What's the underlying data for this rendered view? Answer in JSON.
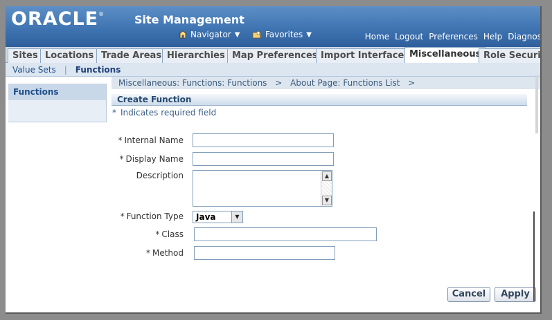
{
  "header": {
    "logo_text": "ORACLE",
    "logo_mark": "®",
    "app_title": "Site Management",
    "navigator_label": "Navigator",
    "favorites_label": "Favorites",
    "global_links": [
      "Home",
      "Logout",
      "Preferences",
      "Help",
      "Diagnosti"
    ]
  },
  "tabs": [
    {
      "label": "Sites",
      "active": false
    },
    {
      "label": "Locations",
      "active": false
    },
    {
      "label": "Trade Areas",
      "active": false
    },
    {
      "label": "Hierarchies",
      "active": false
    },
    {
      "label": "Map Preferences",
      "active": false
    },
    {
      "label": "Import Interface",
      "active": false
    },
    {
      "label": "Miscellaneous",
      "active": true
    },
    {
      "label": "Role Security",
      "active": false
    }
  ],
  "subtabs": {
    "items": [
      "Value Sets",
      "Functions"
    ],
    "separator": "|",
    "active": "Functions"
  },
  "sidenav": {
    "items": [
      "Functions"
    ]
  },
  "breadcrumb": {
    "items": [
      "Miscellaneous: Functions: Functions",
      "About Page: Functions List"
    ],
    "separator": ">"
  },
  "section": {
    "title": "Create Function",
    "required_note": "Indicates required field",
    "required_mark": "*"
  },
  "form": {
    "internal_name": {
      "label": "Internal Name",
      "required": true,
      "value": ""
    },
    "display_name": {
      "label": "Display Name",
      "required": true,
      "value": ""
    },
    "description": {
      "label": "Description",
      "required": false,
      "value": ""
    },
    "function_type": {
      "label": "Function Type",
      "required": true,
      "selected": "Java"
    },
    "class": {
      "label": "Class",
      "required": true,
      "value": ""
    },
    "method": {
      "label": "Method",
      "required": true,
      "value": ""
    }
  },
  "buttons": {
    "cancel": "Cancel",
    "apply": "Apply"
  },
  "icons": {
    "navigator": "house-icon",
    "favorites": "star-folder-icon",
    "dropdown": "triangle-down-icon"
  },
  "colors": {
    "header_blue": "#3f74b2",
    "tab_bg": "#cfdce9",
    "link_blue": "#1f4f8a"
  }
}
